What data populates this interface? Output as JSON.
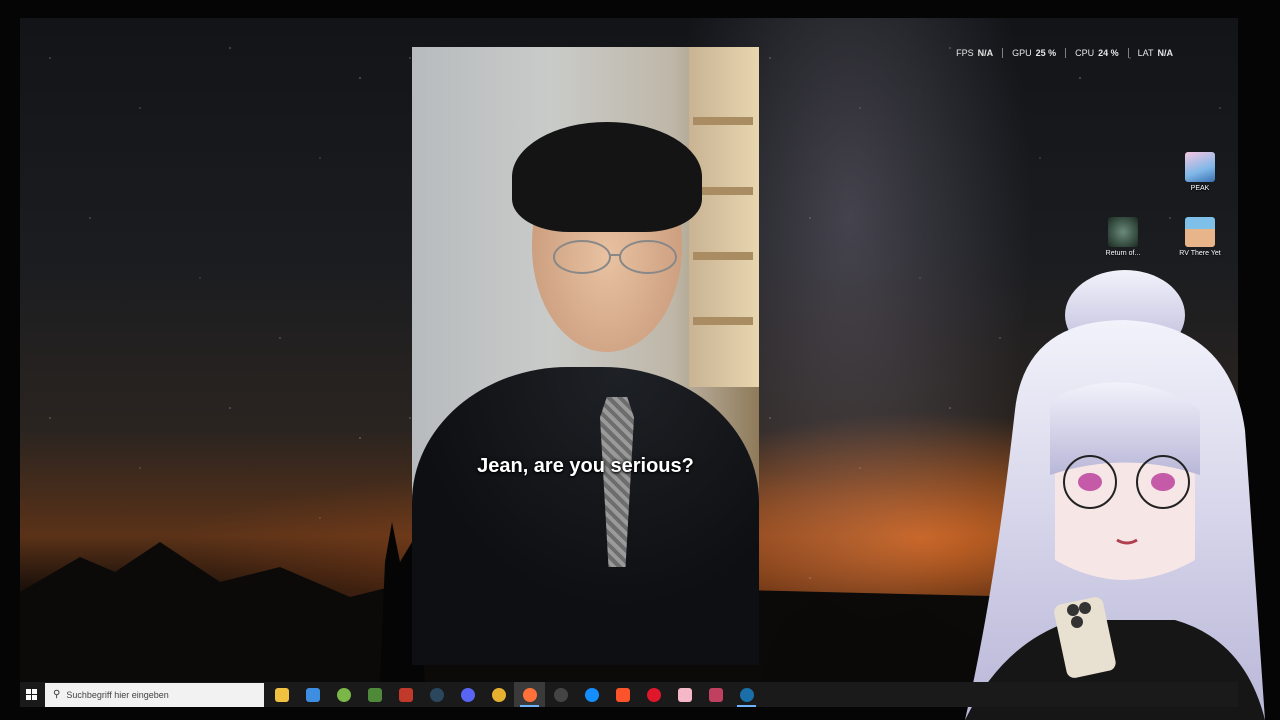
{
  "overlay": {
    "stats": [
      {
        "label": "FPS",
        "value": "N/A"
      },
      {
        "label": "GPU",
        "value": "25 %"
      },
      {
        "label": "CPU",
        "value": "24 %"
      },
      {
        "label": "LAT",
        "value": "N/A"
      }
    ]
  },
  "video": {
    "subtitle": "Jean, are you serious?"
  },
  "desktop_icons": [
    {
      "label": "PEAK",
      "icon": "peak-game-icon",
      "color": "#7fb8e8"
    },
    {
      "label": "Return of...",
      "icon": "returnal-game-icon",
      "color": "#2e4a3a"
    },
    {
      "label": "RV There Yet",
      "icon": "rv-there-yet-game-icon",
      "color": "#d9a27a"
    }
  ],
  "taskbar": {
    "search_placeholder": "Suchbegriff hier eingeben",
    "apps": [
      {
        "icon": "file-explorer-icon",
        "color": "#f0c040"
      },
      {
        "icon": "microsoft-store-icon",
        "color": "#3d8ee0"
      },
      {
        "icon": "android-app-icon",
        "color": "#7ab648"
      },
      {
        "icon": "minecraft-icon",
        "color": "#4e8a3a"
      },
      {
        "icon": "streamer-bot-icon",
        "color": "#c0392b"
      },
      {
        "icon": "steam-icon",
        "color": "#2a475e"
      },
      {
        "icon": "discord-icon",
        "color": "#5865f2"
      },
      {
        "icon": "chrome-icon",
        "color": "#e8b030"
      },
      {
        "icon": "firefox-icon",
        "color": "#ff7139"
      },
      {
        "icon": "obs-studio-icon",
        "color": "#444444"
      },
      {
        "icon": "battle-net-icon",
        "color": "#148eff"
      },
      {
        "icon": "brave-browser-icon",
        "color": "#fb542b"
      },
      {
        "icon": "opera-gx-icon",
        "color": "#e0162b"
      },
      {
        "icon": "vtube-app-icon",
        "color": "#f5b8c8"
      },
      {
        "icon": "app-icon",
        "color": "#c04060"
      },
      {
        "icon": "steam-icon-2",
        "color": "#1b6fa8"
      }
    ]
  }
}
